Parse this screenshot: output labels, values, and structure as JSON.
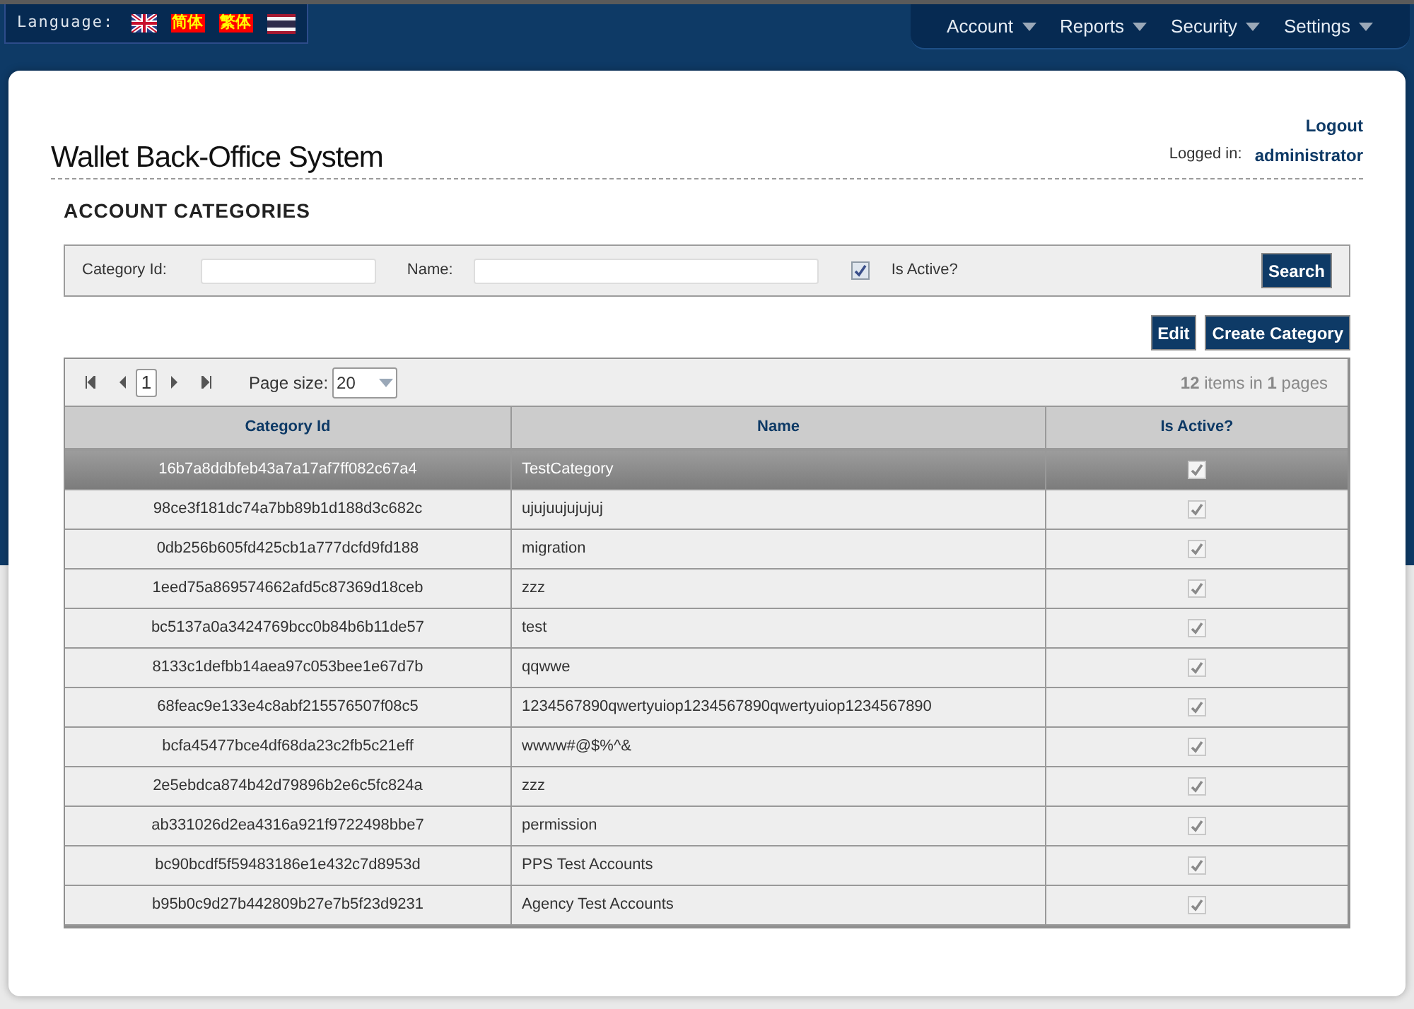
{
  "language_bar": {
    "label": "Language:",
    "options": [
      {
        "kind": "flag-uk"
      },
      {
        "kind": "text",
        "text": "简体"
      },
      {
        "kind": "text",
        "text": "繁体"
      },
      {
        "kind": "flag-th"
      }
    ]
  },
  "nav_menu": [
    "Account",
    "Reports",
    "Security",
    "Settings"
  ],
  "header": {
    "logout": "Logout",
    "title": "Wallet Back-Office System",
    "logged_in_label": "Logged in:",
    "user": "administrator"
  },
  "page_heading": "ACCOUNT CATEGORIES",
  "filter": {
    "category_id_label": "Category Id:",
    "name_label": "Name:",
    "is_active_checked": true,
    "is_active_label": "Is Active?",
    "search_button": "Search"
  },
  "actions": [
    "Edit",
    "Create Category"
  ],
  "pager": {
    "page": "1",
    "page_size_label": "Page size:",
    "page_size": "20",
    "summary": "**12** items in **1** pages"
  },
  "table": {
    "columns": [
      "Category Id",
      "Name",
      "Is Active?"
    ],
    "rows": [
      {
        "id": "16b7a8ddbfeb43a7a17af7ff082c67a4",
        "name": "TestCategory",
        "active": true,
        "selected": true
      },
      {
        "id": "98ce3f181dc74a7bb89b1d188d3c682c",
        "name": "ujujuujujujuj",
        "active": true,
        "selected": false
      },
      {
        "id": "0db256b605fd425cb1a777dcfd9fd188",
        "name": "migration",
        "active": true,
        "selected": false
      },
      {
        "id": "1eed75a869574662afd5c87369d18ceb",
        "name": "zzz",
        "active": true,
        "selected": false
      },
      {
        "id": "bc5137a0a3424769bcc0b84b6b11de57",
        "name": "test",
        "active": true,
        "selected": false
      },
      {
        "id": "8133c1defbb14aea97c053bee1e67d7b",
        "name": "qqwwe",
        "active": true,
        "selected": false
      },
      {
        "id": "68feac9e133e4c8abf215576507f08c5",
        "name": "1234567890qwertyuiop1234567890qwertyuiop1234567890",
        "active": true,
        "selected": false
      },
      {
        "id": "bcfa45477bce4df68da23c2fb5c21eff",
        "name": "wwww#@$%^&",
        "active": true,
        "selected": false
      },
      {
        "id": "2e5ebdca874b42d79896b2e6c5fc824a",
        "name": "zzz",
        "active": true,
        "selected": false
      },
      {
        "id": "ab331026d2ea4316a921f9722498bbe7",
        "name": "permission",
        "active": true,
        "selected": false
      },
      {
        "id": "bc90bcdf5f59483186e1e432c7d8953d",
        "name": "PPS Test Accounts",
        "active": true,
        "selected": false
      },
      {
        "id": "b95b0c9d27b442809b27e7b5f23d9231",
        "name": "Agency Test Accounts",
        "active": true,
        "selected": false
      }
    ]
  }
}
